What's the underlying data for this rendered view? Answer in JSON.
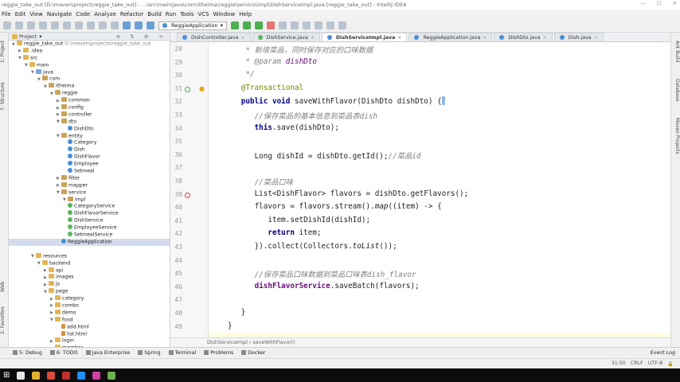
{
  "window": {
    "title": "reggie_take_out [D:\\maven\\project\\reggie_take_out] - ...\\src\\main\\java\\com\\itheima\\reggie\\service\\impl\\DishServiceImpl.java [reggie_take_out] - IntelliJ IDEA"
  },
  "menu": [
    "File",
    "Edit",
    "View",
    "Navigate",
    "Code",
    "Analyze",
    "Refactor",
    "Build",
    "Run",
    "Tools",
    "VCS",
    "Window",
    "Help"
  ],
  "toolbar": {
    "run_config": "ReggieApplication"
  },
  "left_tool_tabs": [
    "1: Project",
    "7: Structure",
    "Web",
    "2: Favorites"
  ],
  "right_tool_tabs": [
    "Ant Build",
    "Database",
    "Maven Projects"
  ],
  "project": {
    "header": "Project",
    "tree": [
      {
        "label": "reggie_take_out",
        "depth": 0,
        "open": true,
        "icon": "folder",
        "suffix": "D:\\maven\\projects\\reggie_take_out"
      },
      {
        "label": ".idea",
        "depth": 1,
        "open": false,
        "icon": "folder"
      },
      {
        "label": "src",
        "depth": 1,
        "open": true,
        "icon": "folder"
      },
      {
        "label": "main",
        "depth": 2,
        "open": true,
        "icon": "folder"
      },
      {
        "label": "java",
        "depth": 3,
        "open": true,
        "icon": "src"
      },
      {
        "label": "com",
        "depth": 4,
        "open": true,
        "icon": "pkg"
      },
      {
        "label": "itheima",
        "depth": 5,
        "open": true,
        "icon": "pkg"
      },
      {
        "label": "reggie",
        "depth": 6,
        "open": true,
        "icon": "pkg"
      },
      {
        "label": "common",
        "depth": 7,
        "open": false,
        "icon": "pkg"
      },
      {
        "label": "config",
        "depth": 7,
        "open": false,
        "icon": "pkg"
      },
      {
        "label": "controller",
        "depth": 7,
        "open": false,
        "icon": "pkg"
      },
      {
        "label": "dto",
        "depth": 7,
        "open": true,
        "icon": "pkg"
      },
      {
        "label": "DishDto",
        "depth": 8,
        "icon": "cls"
      },
      {
        "label": "entity",
        "depth": 7,
        "open": true,
        "icon": "pkg"
      },
      {
        "label": "Category",
        "depth": 8,
        "icon": "cls"
      },
      {
        "label": "Dish",
        "depth": 8,
        "icon": "cls"
      },
      {
        "label": "DishFlavor",
        "depth": 8,
        "icon": "cls"
      },
      {
        "label": "Employee",
        "depth": 8,
        "icon": "cls"
      },
      {
        "label": "Setmeal",
        "depth": 8,
        "icon": "cls"
      },
      {
        "label": "filter",
        "depth": 7,
        "open": false,
        "icon": "pkg"
      },
      {
        "label": "mapper",
        "depth": 7,
        "open": false,
        "icon": "pkg"
      },
      {
        "label": "service",
        "depth": 7,
        "open": true,
        "icon": "pkg"
      },
      {
        "label": "impl",
        "depth": 8,
        "open": true,
        "icon": "pkg"
      },
      {
        "label": "CategoryService",
        "depth": 8,
        "icon": "int"
      },
      {
        "label": "DishFlavorService",
        "depth": 8,
        "icon": "int"
      },
      {
        "label": "DishService",
        "depth": 8,
        "icon": "int"
      },
      {
        "label": "EmployeeService",
        "depth": 8,
        "icon": "int"
      },
      {
        "label": "SetmealService",
        "depth": 8,
        "icon": "int"
      },
      {
        "label": "ReggieApplication",
        "depth": 7,
        "icon": "cls",
        "selected": true
      },
      {
        "label": "",
        "depth": 0,
        "icon": "none"
      },
      {
        "label": "resources",
        "depth": 3,
        "open": true,
        "icon": "folder"
      },
      {
        "label": "backend",
        "depth": 4,
        "open": true,
        "icon": "folder"
      },
      {
        "label": "api",
        "depth": 5,
        "open": false,
        "icon": "folder"
      },
      {
        "label": "images",
        "depth": 5,
        "open": false,
        "icon": "folder"
      },
      {
        "label": "js",
        "depth": 5,
        "open": false,
        "icon": "folder"
      },
      {
        "label": "page",
        "depth": 5,
        "open": true,
        "icon": "folder"
      },
      {
        "label": "category",
        "depth": 6,
        "open": false,
        "icon": "folder"
      },
      {
        "label": "combo",
        "depth": 6,
        "open": false,
        "icon": "folder"
      },
      {
        "label": "demo",
        "depth": 6,
        "open": false,
        "icon": "folder"
      },
      {
        "label": "food",
        "depth": 6,
        "open": true,
        "icon": "folder"
      },
      {
        "label": "add.html",
        "depth": 7,
        "icon": "file"
      },
      {
        "label": "list.html",
        "depth": 7,
        "icon": "file"
      },
      {
        "label": "login",
        "depth": 6,
        "open": false,
        "icon": "folder"
      },
      {
        "label": "member",
        "depth": 6,
        "open": false,
        "icon": "folder"
      }
    ]
  },
  "tabs": [
    {
      "label": "DishController.java",
      "active": false
    },
    {
      "label": "DishService.java",
      "active": false
    },
    {
      "label": "DishServiceImpl.java",
      "active": true
    },
    {
      "label": "ReggieApplication.java",
      "active": false
    },
    {
      "label": "DishDto.java",
      "active": false
    },
    {
      "label": "Dish.java",
      "active": false
    }
  ],
  "code": {
    "line_numbers": [
      "28",
      "29",
      "30",
      "31",
      "32",
      "33",
      "34",
      "35",
      "36",
      "37",
      "38",
      "39",
      "40",
      "41",
      "42",
      "43",
      "44",
      "45",
      "46",
      "47",
      "48",
      "49"
    ],
    "lines": [
      [
        {
          "t": "    * 新增菜品，同时保存对应的口味数据",
          "c": "cm"
        }
      ],
      [
        {
          "t": "    * ",
          "c": "cm"
        },
        {
          "t": "@param ",
          "c": "cm"
        },
        {
          "t": "dishDto",
          "c": "pm"
        }
      ],
      [
        {
          "t": "    */",
          "c": "cm"
        }
      ],
      [
        {
          "t": "   @Transactional",
          "c": "an"
        }
      ],
      [
        {
          "t": "   public void ",
          "c": "kw"
        },
        {
          "t": "saveWithFlavor(DishDto dishDto) {"
        }
      ],
      [
        {
          "t": "      //保存菜品的基本信息到菜品表dish",
          "c": "cm"
        }
      ],
      [
        {
          "t": "      this",
          "c": "kw"
        },
        {
          "t": ".save(dishDto);"
        }
      ],
      [
        {
          "t": ""
        }
      ],
      [
        {
          "t": "      Long dishId = dishDto.getId();"
        },
        {
          "t": "//菜品id",
          "c": "cm"
        }
      ],
      [
        {
          "t": ""
        }
      ],
      [
        {
          "t": "      //菜品口味",
          "c": "cm"
        }
      ],
      [
        {
          "t": "      List<DishFlavor> flavors = dishDto.getFlavors();"
        }
      ],
      [
        {
          "t": "      flavors = flavors.stream()."
        },
        {
          "t": "map",
          "c": "mi"
        },
        {
          "t": "((item) -> {"
        }
      ],
      [
        {
          "t": "         item.setDishId(dishId);"
        }
      ],
      [
        {
          "t": "         return ",
          "c": "kw"
        },
        {
          "t": "item;"
        }
      ],
      [
        {
          "t": "      }).collect(Collectors."
        },
        {
          "t": "toList",
          "c": "mi"
        },
        {
          "t": "());"
        }
      ],
      [
        {
          "t": ""
        }
      ],
      [
        {
          "t": "      //保存菜品口味数据到菜品口味表dish_flavor",
          "c": "cm"
        }
      ],
      [
        {
          "t": "      "
        },
        {
          "t": "dishFlavorService",
          "c": "fd"
        },
        {
          "t": ".saveBatch(flavors);"
        }
      ],
      [
        {
          "t": ""
        }
      ],
      [
        {
          "t": "   }"
        }
      ],
      [
        {
          "t": "}"
        }
      ]
    ]
  },
  "breadcrumb": "DishServiceImpl › saveWithFlavor()",
  "bottom_tabs": [
    "5: Debug",
    "6: TODO",
    "Java Enterprise",
    "Spring",
    "Terminal",
    "Problems",
    "Docker"
  ],
  "event_log": "Event Log",
  "status": {
    "position": "31:50",
    "line_sep": "CRLF",
    "encoding": "UTF-8"
  },
  "colors": {
    "keyword": "#000080",
    "comment": "#808080",
    "annotation": "#808000",
    "field": "#660e7a",
    "selection": "#d4dcec"
  }
}
